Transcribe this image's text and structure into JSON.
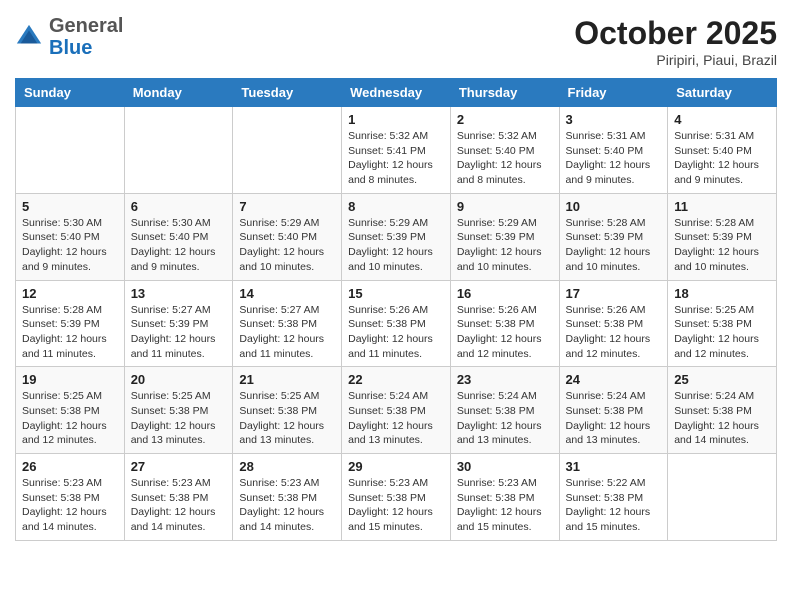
{
  "header": {
    "logo_general": "General",
    "logo_blue": "Blue",
    "month_title": "October 2025",
    "subtitle": "Piripiri, Piaui, Brazil"
  },
  "days_of_week": [
    "Sunday",
    "Monday",
    "Tuesday",
    "Wednesday",
    "Thursday",
    "Friday",
    "Saturday"
  ],
  "weeks": [
    [
      {
        "day": "",
        "info": ""
      },
      {
        "day": "",
        "info": ""
      },
      {
        "day": "",
        "info": ""
      },
      {
        "day": "1",
        "info": "Sunrise: 5:32 AM\nSunset: 5:41 PM\nDaylight: 12 hours\nand 8 minutes."
      },
      {
        "day": "2",
        "info": "Sunrise: 5:32 AM\nSunset: 5:40 PM\nDaylight: 12 hours\nand 8 minutes."
      },
      {
        "day": "3",
        "info": "Sunrise: 5:31 AM\nSunset: 5:40 PM\nDaylight: 12 hours\nand 9 minutes."
      },
      {
        "day": "4",
        "info": "Sunrise: 5:31 AM\nSunset: 5:40 PM\nDaylight: 12 hours\nand 9 minutes."
      }
    ],
    [
      {
        "day": "5",
        "info": "Sunrise: 5:30 AM\nSunset: 5:40 PM\nDaylight: 12 hours\nand 9 minutes."
      },
      {
        "day": "6",
        "info": "Sunrise: 5:30 AM\nSunset: 5:40 PM\nDaylight: 12 hours\nand 9 minutes."
      },
      {
        "day": "7",
        "info": "Sunrise: 5:29 AM\nSunset: 5:40 PM\nDaylight: 12 hours\nand 10 minutes."
      },
      {
        "day": "8",
        "info": "Sunrise: 5:29 AM\nSunset: 5:39 PM\nDaylight: 12 hours\nand 10 minutes."
      },
      {
        "day": "9",
        "info": "Sunrise: 5:29 AM\nSunset: 5:39 PM\nDaylight: 12 hours\nand 10 minutes."
      },
      {
        "day": "10",
        "info": "Sunrise: 5:28 AM\nSunset: 5:39 PM\nDaylight: 12 hours\nand 10 minutes."
      },
      {
        "day": "11",
        "info": "Sunrise: 5:28 AM\nSunset: 5:39 PM\nDaylight: 12 hours\nand 10 minutes."
      }
    ],
    [
      {
        "day": "12",
        "info": "Sunrise: 5:28 AM\nSunset: 5:39 PM\nDaylight: 12 hours\nand 11 minutes."
      },
      {
        "day": "13",
        "info": "Sunrise: 5:27 AM\nSunset: 5:39 PM\nDaylight: 12 hours\nand 11 minutes."
      },
      {
        "day": "14",
        "info": "Sunrise: 5:27 AM\nSunset: 5:38 PM\nDaylight: 12 hours\nand 11 minutes."
      },
      {
        "day": "15",
        "info": "Sunrise: 5:26 AM\nSunset: 5:38 PM\nDaylight: 12 hours\nand 11 minutes."
      },
      {
        "day": "16",
        "info": "Sunrise: 5:26 AM\nSunset: 5:38 PM\nDaylight: 12 hours\nand 12 minutes."
      },
      {
        "day": "17",
        "info": "Sunrise: 5:26 AM\nSunset: 5:38 PM\nDaylight: 12 hours\nand 12 minutes."
      },
      {
        "day": "18",
        "info": "Sunrise: 5:25 AM\nSunset: 5:38 PM\nDaylight: 12 hours\nand 12 minutes."
      }
    ],
    [
      {
        "day": "19",
        "info": "Sunrise: 5:25 AM\nSunset: 5:38 PM\nDaylight: 12 hours\nand 12 minutes."
      },
      {
        "day": "20",
        "info": "Sunrise: 5:25 AM\nSunset: 5:38 PM\nDaylight: 12 hours\nand 13 minutes."
      },
      {
        "day": "21",
        "info": "Sunrise: 5:25 AM\nSunset: 5:38 PM\nDaylight: 12 hours\nand 13 minutes."
      },
      {
        "day": "22",
        "info": "Sunrise: 5:24 AM\nSunset: 5:38 PM\nDaylight: 12 hours\nand 13 minutes."
      },
      {
        "day": "23",
        "info": "Sunrise: 5:24 AM\nSunset: 5:38 PM\nDaylight: 12 hours\nand 13 minutes."
      },
      {
        "day": "24",
        "info": "Sunrise: 5:24 AM\nSunset: 5:38 PM\nDaylight: 12 hours\nand 13 minutes."
      },
      {
        "day": "25",
        "info": "Sunrise: 5:24 AM\nSunset: 5:38 PM\nDaylight: 12 hours\nand 14 minutes."
      }
    ],
    [
      {
        "day": "26",
        "info": "Sunrise: 5:23 AM\nSunset: 5:38 PM\nDaylight: 12 hours\nand 14 minutes."
      },
      {
        "day": "27",
        "info": "Sunrise: 5:23 AM\nSunset: 5:38 PM\nDaylight: 12 hours\nand 14 minutes."
      },
      {
        "day": "28",
        "info": "Sunrise: 5:23 AM\nSunset: 5:38 PM\nDaylight: 12 hours\nand 14 minutes."
      },
      {
        "day": "29",
        "info": "Sunrise: 5:23 AM\nSunset: 5:38 PM\nDaylight: 12 hours\nand 15 minutes."
      },
      {
        "day": "30",
        "info": "Sunrise: 5:23 AM\nSunset: 5:38 PM\nDaylight: 12 hours\nand 15 minutes."
      },
      {
        "day": "31",
        "info": "Sunrise: 5:22 AM\nSunset: 5:38 PM\nDaylight: 12 hours\nand 15 minutes."
      },
      {
        "day": "",
        "info": ""
      }
    ]
  ]
}
